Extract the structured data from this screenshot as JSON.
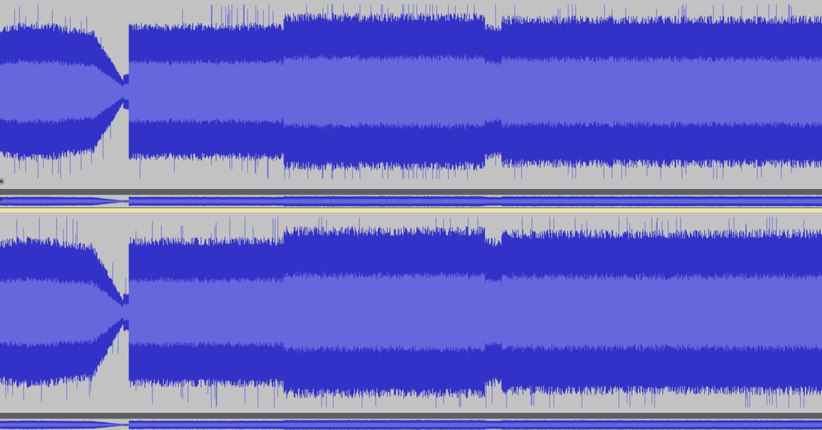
{
  "app": {
    "view": "waveform-editor"
  },
  "colors": {
    "background": "#c2c2c2",
    "waveform_peak": "#3232c8",
    "waveform_rms": "#6666dd",
    "waveform_spike": "#6f6fd8",
    "divider": "#5d5f66",
    "selected_divider": "#e8e6a4"
  },
  "tracks": [
    {
      "id": "channel-1",
      "seed": 11
    },
    {
      "id": "channel-2",
      "seed": 29
    }
  ],
  "icons": {
    "collapse_marker": "snowflake-icon"
  }
}
